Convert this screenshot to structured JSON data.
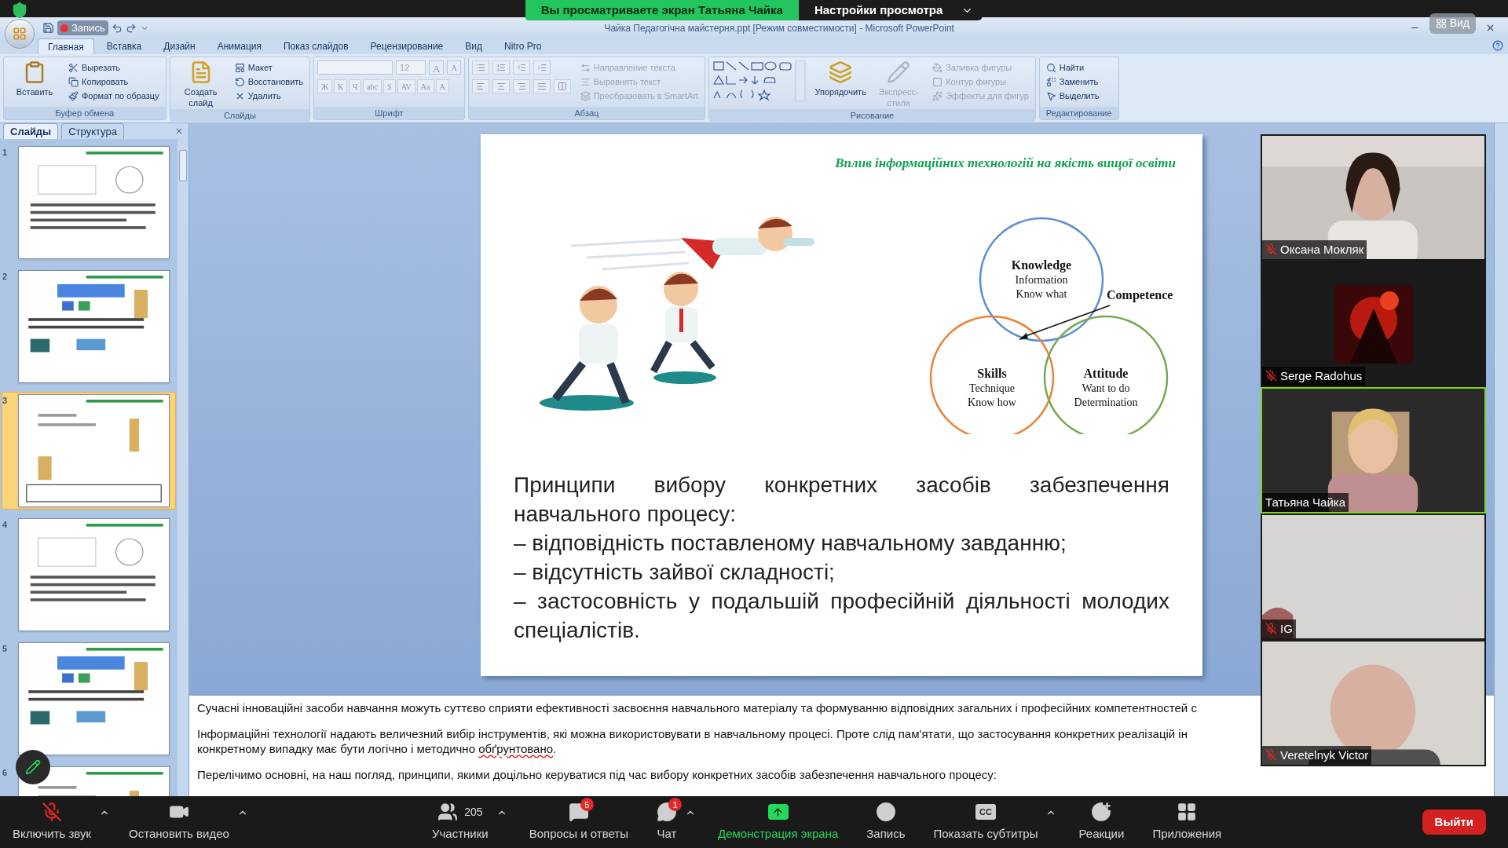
{
  "zoom_banner": {
    "sharing_text": "Вы просматриваете экран Татьяна Чайка",
    "options": "Настройки просмотра"
  },
  "recording": {
    "label": "Запись",
    "on": true
  },
  "view_button": "Вид",
  "window": {
    "title": "Чайка Педагогічна майстерня.ppt [Режим совместимости] - Microsoft PowerPoint"
  },
  "ribbon_tabs": [
    {
      "label": "Главная",
      "selected": true
    },
    {
      "label": "Вставка",
      "selected": false
    },
    {
      "label": "Дизайн",
      "selected": false
    },
    {
      "label": "Анимация",
      "selected": false
    },
    {
      "label": "Показ слайдов",
      "selected": false
    },
    {
      "label": "Рецензирование",
      "selected": false
    },
    {
      "label": "Вид",
      "selected": false
    },
    {
      "label": "Nitro Pro",
      "selected": false
    }
  ],
  "ribbon_groups": [
    {
      "kind": "clipboard",
      "title": "Буфер обмена",
      "large": [
        {
          "label": "Вставить",
          "disabled": false
        }
      ],
      "small": [
        {
          "label": "Вырезать",
          "disabled": false
        },
        {
          "label": "Копировать",
          "disabled": false
        },
        {
          "label": "Формат по образцу",
          "disabled": false
        }
      ]
    },
    {
      "kind": "slides",
      "title": "Слайды",
      "large": [
        {
          "label": "Создать слайд",
          "disabled": false
        }
      ],
      "small": [
        {
          "label": "Макет",
          "disabled": false
        },
        {
          "label": "Восстановить",
          "disabled": false
        },
        {
          "label": "Удалить",
          "disabled": false
        }
      ]
    },
    {
      "kind": "font",
      "title": "Шрифт",
      "font_size": "12",
      "size_buttons": [
        "A",
        "A"
      ],
      "format_buttons": [
        "Ж",
        "К",
        "Ч",
        "abc",
        "S",
        "AV",
        "Aa",
        "A"
      ]
    },
    {
      "kind": "paragraph",
      "title": "Абзац",
      "small": [
        {
          "label": "Направление текста",
          "disabled": true
        },
        {
          "label": "Выровнять текст",
          "disabled": true
        },
        {
          "label": "Преобразовать в SmartArt",
          "disabled": true
        }
      ]
    },
    {
      "kind": "drawing",
      "title": "Рисование",
      "large": [
        {
          "label": "Упорядочить",
          "disabled": false
        },
        {
          "label": "Экспресс-стили",
          "disabled": true
        }
      ],
      "small": [
        {
          "label": "Заливка фигуры",
          "disabled": true
        },
        {
          "label": "Контур фигуры",
          "disabled": true
        },
        {
          "label": "Эффекты для фигур",
          "disabled": true
        }
      ]
    },
    {
      "kind": "editing",
      "title": "Редактирование",
      "small": [
        {
          "label": "Найти",
          "disabled": false
        },
        {
          "label": "Заменить",
          "disabled": false
        },
        {
          "label": "Выделить",
          "disabled": false
        }
      ]
    }
  ],
  "panel_tabs": [
    {
      "label": "Слайды",
      "selected": true
    },
    {
      "label": "Структура",
      "selected": false
    }
  ],
  "slides": [
    {
      "number": "1",
      "selected": false
    },
    {
      "number": "2",
      "selected": false
    },
    {
      "number": "3",
      "selected": true
    },
    {
      "number": "4",
      "selected": false
    },
    {
      "number": "5",
      "selected": false
    },
    {
      "number": "6",
      "selected": false
    }
  ],
  "slide": {
    "title": "Вплив інформаційних технологій на якість вищої освіти",
    "venn": [
      {
        "title": "Knowledge",
        "lines": [
          "Information",
          "Know what"
        ]
      },
      {
        "title": "Skills",
        "lines": [
          "Technique",
          "Know how"
        ]
      },
      {
        "title": "Attitude",
        "lines": [
          "Want to do",
          "Determination"
        ]
      }
    ],
    "competence": "Competence",
    "intro": "Принципи вибору конкретних засобів забезпечення навчального процесу:",
    "points": [
      "– відповідність поставленому навчальному завданню;",
      "– відсутність зайвої складності;",
      "– застосовність у подальшій професійній діяльності молодих спеціалістів."
    ]
  },
  "notes": [
    [
      [
        {
          "text": "Сучасні інноваційні засоби навчання можуть суттєво сприяти ефективності засвоєння навчального матеріалу та формуванню відповідних загальних і професійних компетентностей с",
          "misspelled": false
        }
      ]
    ],
    [
      [
        {
          "text": "Інформаційні технології надають величезний вибір інструментів, які можна використовувати в навчальному процесі. Проте слід пам'ятати, що застосування конкретних реалізацій ін",
          "misspelled": false
        }
      ],
      [
        {
          "text": "конкретному випадку має бути логічно і методично ",
          "misspelled": false
        },
        {
          "text": "обґрунтовано",
          "misspelled": true
        },
        {
          "text": ".",
          "misspelled": false
        }
      ]
    ],
    [
      [
        {
          "text": "Перелічимо основні, на наш погляд, принципи, якими доцільно керуватися під час вибору конкретних засобів забезпечення  навчального процесу:",
          "misspelled": false
        }
      ]
    ]
  ],
  "participants": [
    {
      "name": "Оксана Мокляк",
      "muted": true,
      "speaking": false,
      "kind": "camera"
    },
    {
      "name": "Serge Radohus",
      "muted": true,
      "speaking": false,
      "kind": "avatar"
    },
    {
      "name": "Татьяна Чайка",
      "muted": false,
      "speaking": true,
      "kind": "camera"
    },
    {
      "name": "IG",
      "muted": true,
      "speaking": false,
      "kind": "camera"
    },
    {
      "name": "Veretelnyk Victor",
      "muted": true,
      "speaking": false,
      "kind": "camera"
    }
  ],
  "toolbar": [
    {
      "kind": "mic",
      "label": "Включить звук",
      "caret": true
    },
    {
      "kind": "video",
      "label": "Остановить видео",
      "caret": true
    },
    {
      "kind": "participants",
      "label": "Участники",
      "count": "205",
      "caret": true
    },
    {
      "kind": "qa",
      "label": "Вопросы и ответы",
      "badge": "5",
      "caret": false
    },
    {
      "kind": "chat",
      "label": "Чат",
      "badge": "1",
      "caret": true
    },
    {
      "kind": "share",
      "label": "Демонстрация экрана",
      "caret": false
    },
    {
      "kind": "record",
      "label": "Запись",
      "caret": false
    },
    {
      "kind": "captions",
      "label": "Показать субтитры",
      "glyph": "CC",
      "caret": true
    },
    {
      "kind": "reactions",
      "label": "Реакции",
      "caret": false
    },
    {
      "kind": "apps",
      "label": "Приложения",
      "caret": false
    }
  ],
  "leave_button": "Выйти"
}
